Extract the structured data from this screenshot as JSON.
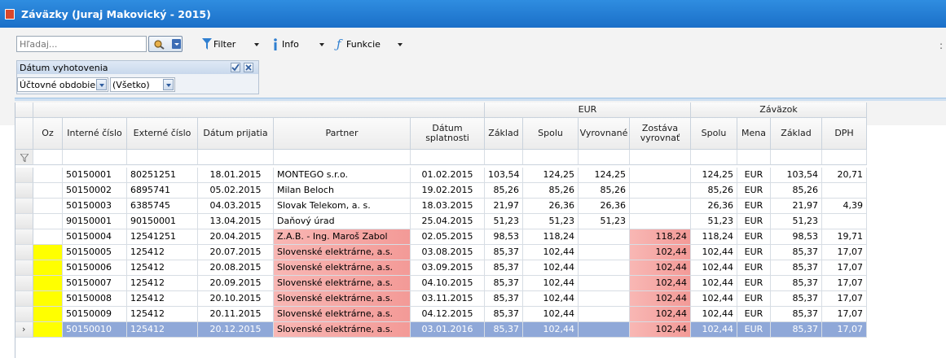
{
  "window": {
    "title": "Záväzky (Juraj Makovický - 2015)"
  },
  "toolbar": {
    "search_placeholder": "Hľadaj...",
    "filter_label": "Filter",
    "info_label": "Info",
    "functions_label": "Funkcie",
    "overflow_glyph": ":"
  },
  "filter_panel": {
    "title": "Dátum vyhotovenia",
    "period_label": "Účtovné obdobie",
    "value": "(Všetko)"
  },
  "table": {
    "group_headers": {
      "eur": "EUR",
      "zavazok": "Záväzok"
    },
    "columns": [
      "Oz",
      "Interné číslo",
      "Externé číslo",
      "Dátum prijatia",
      "Partner",
      "Dátum splatnosti",
      "Základ",
      "Spolu",
      "Vyrovnané",
      "Zostáva vyrovnať",
      "Spolu",
      "Mena",
      "Základ",
      "DPH"
    ],
    "rows": [
      {
        "oz": "",
        "interne": "50150001",
        "externe": "80251251",
        "prijatie": "18.01.2015",
        "partner": "MONTEGO s.r.o.",
        "splatnost": "01.02.2015",
        "eur_zaklad": "103,54",
        "eur_spolu": "124,25",
        "vyrovnane": "124,25",
        "zostava": "",
        "z_spolu": "124,25",
        "mena": "EUR",
        "z_zaklad": "103,54",
        "dph": "20,71"
      },
      {
        "oz": "",
        "interne": "50150002",
        "externe": "6895741",
        "prijatie": "05.02.2015",
        "partner": "Milan Beloch",
        "splatnost": "19.02.2015",
        "eur_zaklad": "85,26",
        "eur_spolu": "85,26",
        "vyrovnane": "85,26",
        "zostava": "",
        "z_spolu": "85,26",
        "mena": "EUR",
        "z_zaklad": "85,26",
        "dph": ""
      },
      {
        "oz": "",
        "interne": "50150003",
        "externe": "6385745",
        "prijatie": "04.03.2015",
        "partner": "Slovak Telekom, a. s.",
        "splatnost": "18.03.2015",
        "eur_zaklad": "21,97",
        "eur_spolu": "26,36",
        "vyrovnane": "26,36",
        "zostava": "",
        "z_spolu": "26,36",
        "mena": "EUR",
        "z_zaklad": "21,97",
        "dph": "4,39"
      },
      {
        "oz": "",
        "interne": "90150001",
        "externe": "90150001",
        "prijatie": "13.04.2015",
        "partner": "Daňový úrad",
        "splatnost": "25.04.2015",
        "eur_zaklad": "51,23",
        "eur_spolu": "51,23",
        "vyrovnane": "51,23",
        "zostava": "",
        "z_spolu": "51,23",
        "mena": "EUR",
        "z_zaklad": "51,23",
        "dph": ""
      },
      {
        "oz": "",
        "interne": "50150004",
        "externe": "12541251",
        "prijatie": "20.04.2015",
        "partner": "Z.A.B. - Ing. Maroš Zabol",
        "splatnost": "02.05.2015",
        "eur_zaklad": "98,53",
        "eur_spolu": "118,24",
        "vyrovnane": "",
        "zostava": "118,24",
        "z_spolu": "118,24",
        "mena": "EUR",
        "z_zaklad": "98,53",
        "dph": "19,71"
      },
      {
        "oz": "",
        "interne": "50150005",
        "externe": "125412",
        "prijatie": "20.07.2015",
        "partner": "Slovenské elektrárne, a.s.",
        "splatnost": "03.08.2015",
        "eur_zaklad": "85,37",
        "eur_spolu": "102,44",
        "vyrovnane": "",
        "zostava": "102,44",
        "z_spolu": "102,44",
        "mena": "EUR",
        "z_zaklad": "85,37",
        "dph": "17,07"
      },
      {
        "oz": "",
        "interne": "50150006",
        "externe": "125412",
        "prijatie": "20.08.2015",
        "partner": "Slovenské elektrárne, a.s.",
        "splatnost": "03.09.2015",
        "eur_zaklad": "85,37",
        "eur_spolu": "102,44",
        "vyrovnane": "",
        "zostava": "102,44",
        "z_spolu": "102,44",
        "mena": "EUR",
        "z_zaklad": "85,37",
        "dph": "17,07"
      },
      {
        "oz": "",
        "interne": "50150007",
        "externe": "125412",
        "prijatie": "20.09.2015",
        "partner": "Slovenské elektrárne, a.s.",
        "splatnost": "04.10.2015",
        "eur_zaklad": "85,37",
        "eur_spolu": "102,44",
        "vyrovnane": "",
        "zostava": "102,44",
        "z_spolu": "102,44",
        "mena": "EUR",
        "z_zaklad": "85,37",
        "dph": "17,07"
      },
      {
        "oz": "",
        "interne": "50150008",
        "externe": "125412",
        "prijatie": "20.10.2015",
        "partner": "Slovenské elektrárne, a.s.",
        "splatnost": "03.11.2015",
        "eur_zaklad": "85,37",
        "eur_spolu": "102,44",
        "vyrovnane": "",
        "zostava": "102,44",
        "z_spolu": "102,44",
        "mena": "EUR",
        "z_zaklad": "85,37",
        "dph": "17,07"
      },
      {
        "oz": "",
        "interne": "50150009",
        "externe": "125412",
        "prijatie": "20.11.2015",
        "partner": "Slovenské elektrárne, a.s.",
        "splatnost": "04.12.2015",
        "eur_zaklad": "85,37",
        "eur_spolu": "102,44",
        "vyrovnane": "",
        "zostava": "102,44",
        "z_spolu": "102,44",
        "mena": "EUR",
        "z_zaklad": "85,37",
        "dph": "17,07"
      },
      {
        "oz": "",
        "interne": "50150010",
        "externe": "125412",
        "prijatie": "20.12.2015",
        "partner": "Slovenské elektrárne, a.s.",
        "splatnost": "03.01.2016",
        "eur_zaklad": "85,37",
        "eur_spolu": "102,44",
        "vyrovnane": "",
        "zostava": "102,44",
        "z_spolu": "102,44",
        "mena": "EUR",
        "z_zaklad": "85,37",
        "dph": "17,07"
      }
    ]
  },
  "colors": {
    "title_bar": "#1b6fc8",
    "overdue_highlight": "#f4a4a0",
    "marker_yellow": "#ffff00",
    "selected_row": "#8fa8d8"
  }
}
